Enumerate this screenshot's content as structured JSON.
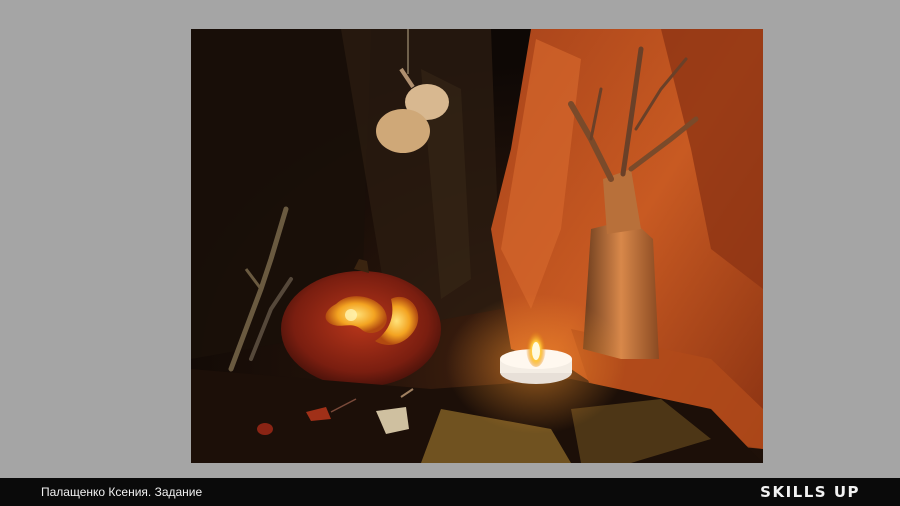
{
  "footer": {
    "caption": "Палащенко Ксения. Задание",
    "logo_text": "SKILLS UP"
  },
  "colors": {
    "slide_background": "#a5a5a5",
    "footer_background": "#0a0a0a",
    "drapery_orange": "#c0521c",
    "candle_flame": "#ffd24a"
  }
}
